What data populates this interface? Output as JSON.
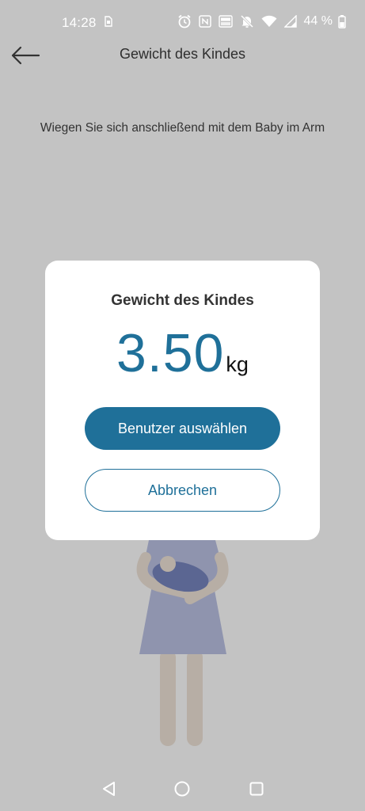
{
  "status_bar": {
    "time": "14:28",
    "battery": "44 %",
    "icons": [
      "sim-card-icon",
      "alarm-icon",
      "nfc-icon",
      "volte-icon",
      "bell-off-icon",
      "wifi-icon",
      "signal-icon",
      "battery-icon"
    ]
  },
  "app_bar": {
    "title": "Gewicht des Kindes",
    "back_icon": "arrow-left-icon"
  },
  "instruction": "Wiegen Sie sich anschließend mit dem Baby im Arm",
  "dialog": {
    "title": "Gewicht des Kindes",
    "weight_value": "3.50",
    "weight_unit": "kg",
    "primary_button": "Benutzer auswählen",
    "secondary_button": "Abbrechen"
  },
  "nav_bar": {
    "icons": [
      "back-triangle-icon",
      "home-circle-icon",
      "recents-square-icon"
    ]
  },
  "colors": {
    "accent": "#1f7099",
    "overlay_background": "#c3c3c3",
    "dialog_background": "#ffffff"
  }
}
